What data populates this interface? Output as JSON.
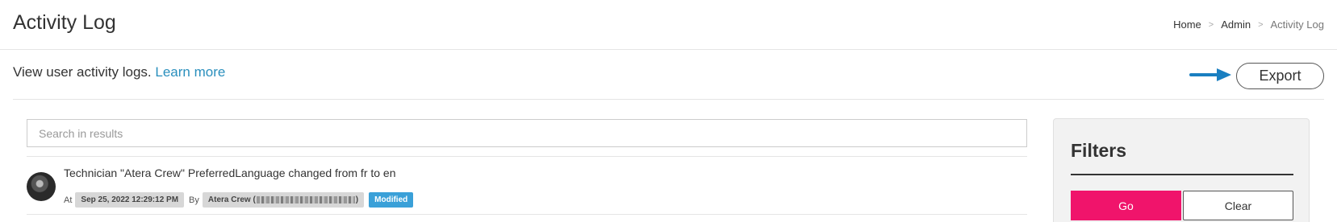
{
  "header": {
    "title": "Activity Log",
    "breadcrumb": [
      {
        "label": "Home"
      },
      {
        "label": "Admin"
      },
      {
        "label": "Activity Log"
      }
    ],
    "separator": ">"
  },
  "subheader": {
    "description": "View user activity logs.",
    "learn_more": "Learn more",
    "export_label": "Export",
    "arrow_color": "#1a7fc1"
  },
  "search": {
    "placeholder": "Search in results",
    "value": ""
  },
  "log_entries": [
    {
      "text": "Technician \"Atera Crew\" PreferredLanguage changed from fr to en",
      "at_label": "At",
      "timestamp": "Sep 25, 2022 12:29:12 PM",
      "by_label": "By",
      "user": "Atera Crew (",
      "user_suffix": ")",
      "action": "Modified"
    }
  ],
  "filters": {
    "title": "Filters",
    "go_label": "Go",
    "clear_label": "Clear"
  },
  "colors": {
    "accent_pink": "#f0146b",
    "link_blue": "#2a8fbd",
    "badge_blue": "#3aa0d8"
  }
}
